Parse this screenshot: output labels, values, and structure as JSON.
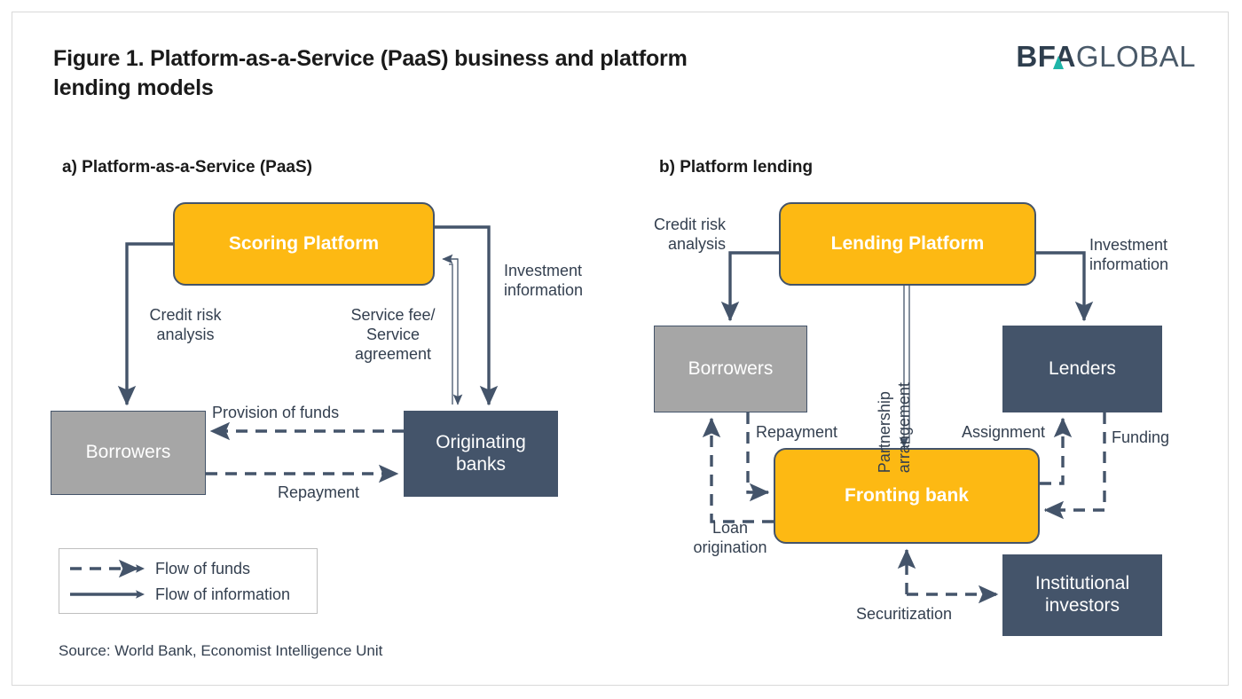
{
  "figure": {
    "title": "Figure 1. Platform-as-a-Service (PaaS) business and platform lending models",
    "source": "Source: World Bank, Economist Intelligence Unit"
  },
  "logo": {
    "bold_part": "BFA",
    "light_part": "GLOBAL",
    "accent_color": "#1fb5a8",
    "text_color": "#2e3e4e"
  },
  "colors": {
    "platform_orange": "#fdb913",
    "actor_gray": "#a6a6a6",
    "actor_navy": "#44546a",
    "line_navy": "#44546a",
    "frame_gray": "#d9d9d9"
  },
  "panel_a": {
    "heading": "a) Platform-as-a-Service (PaaS)",
    "nodes": {
      "platform": "Scoring Platform",
      "borrowers": "Borrowers",
      "banks": "Originating\nbanks"
    },
    "labels": {
      "credit_risk": "Credit risk\nanalysis",
      "service_fee": "Service fee/\nService\nagreement",
      "investment_info": "Investment\ninformation",
      "provision": "Provision of funds",
      "repayment": "Repayment"
    }
  },
  "panel_b": {
    "heading": "b) Platform lending",
    "nodes": {
      "platform": "Lending Platform",
      "borrowers": "Borrowers",
      "lenders": "Lenders",
      "fronting_bank": "Fronting bank",
      "institutional": "Institutional\ninvestors"
    },
    "labels": {
      "credit_risk": "Credit risk\nanalysis",
      "investment_info": "Investment\ninformation",
      "partnership": "Partnership\narrangement",
      "repayment": "Repayment",
      "loan_origination": "Loan\norigination",
      "assignment": "Assignment",
      "funding": "Funding",
      "securitization": "Securitization"
    }
  },
  "legend": {
    "funds": "Flow of funds",
    "information": "Flow of information"
  }
}
